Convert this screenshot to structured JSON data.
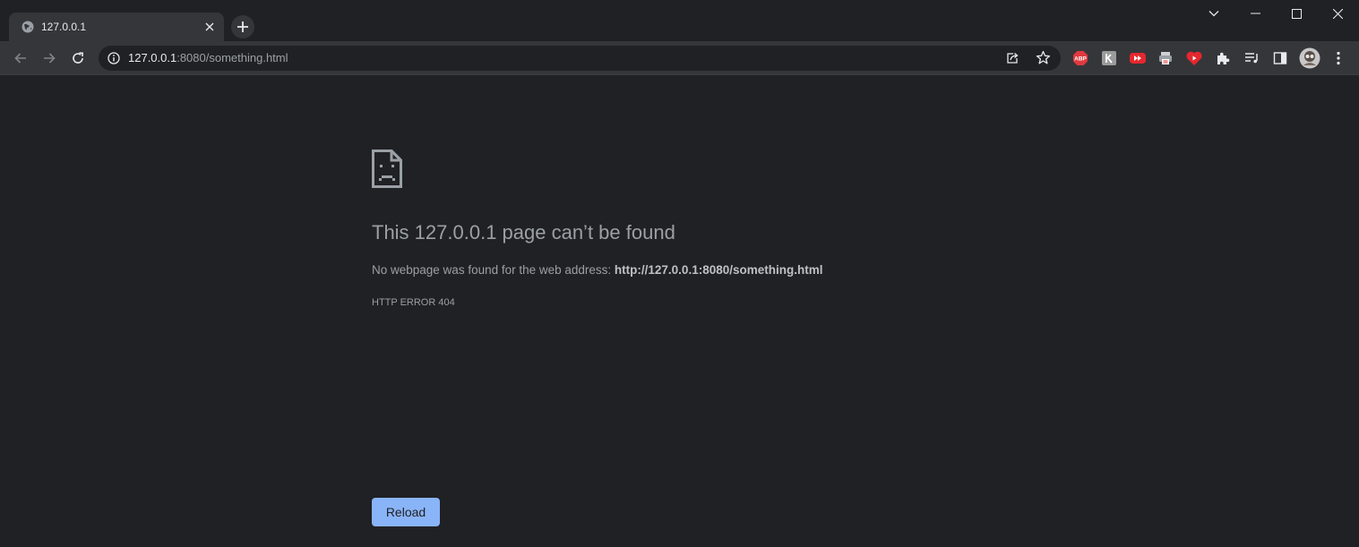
{
  "tab": {
    "title": "127.0.0.1"
  },
  "omnibox": {
    "host": "127.0.0.1",
    "rest": ":8080/something.html"
  },
  "extensions": [
    {
      "name": "abp-icon",
      "label": "ABP"
    }
  ],
  "error": {
    "title": "This 127.0.0.1 page can’t be found",
    "description_prefix": "No webpage was found for the web address: ",
    "description_url": "http://127.0.0.1:8080/something.html",
    "code": "HTTP ERROR 404",
    "reload_label": "Reload"
  },
  "colors": {
    "background": "#202124",
    "toolbar": "#35363a",
    "accent": "#8ab4f8",
    "text_muted": "#9aa0a6"
  }
}
